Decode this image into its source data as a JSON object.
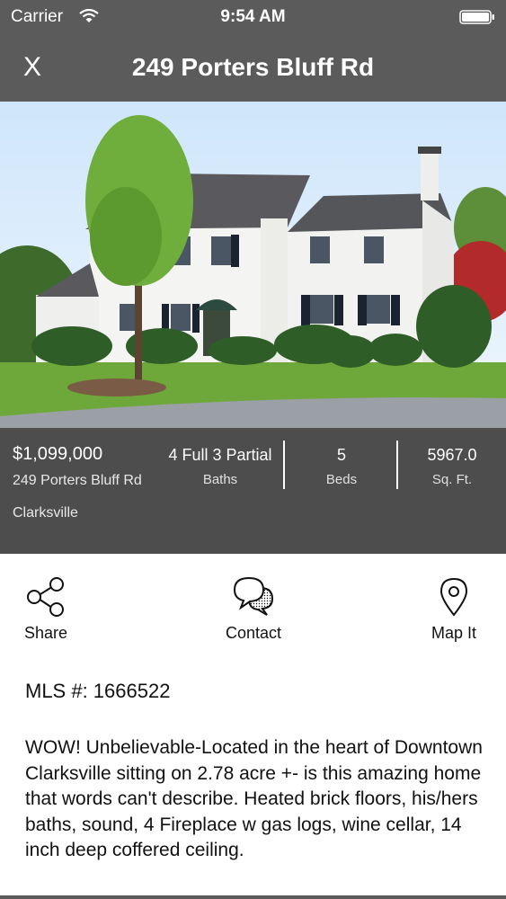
{
  "status_bar": {
    "carrier": "Carrier",
    "time": "9:54 AM",
    "icons": [
      "wifi-icon",
      "battery-icon"
    ]
  },
  "nav": {
    "close_label": "X",
    "title": "249 Porters Bluff Rd"
  },
  "listing": {
    "price": "$1,099,000",
    "address": "249 Porters Bluff Rd",
    "city": "Clarksville",
    "baths_value": "4 Full 3 Partial",
    "baths_label": "Baths",
    "beds_value": "5",
    "beds_label": "Beds",
    "sqft_value": "5967.0",
    "sqft_label": "Sq. Ft."
  },
  "actions": {
    "share_label": "Share",
    "contact_label": "Contact",
    "map_label": "Map It",
    "icons": [
      "share-icon",
      "chat-bubbles-icon",
      "map-pin-icon"
    ]
  },
  "details": {
    "mls": "MLS #: 1666522",
    "description": "WOW! Unbelievable-Located in the heart of Downtown Clarksville sitting on 2.78 acre +- is this amazing home that words can't describe. Heated brick floors, his/hers baths, sound, 4 Fireplace w gas logs, wine cellar, 14 inch deep coffered ceiling."
  },
  "colors": {
    "nav_bg": "#5b5b5b",
    "info_bg": "#4d4d4d",
    "text_dark": "#111111"
  }
}
